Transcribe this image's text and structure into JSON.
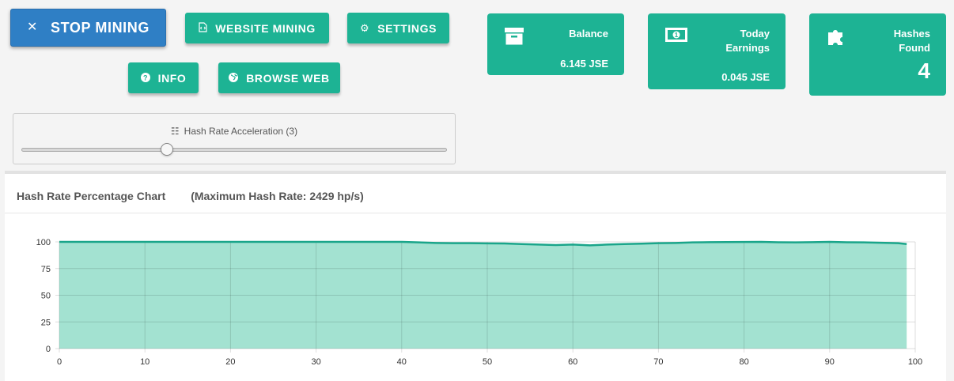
{
  "buttons": {
    "stop_mining": "STOP MINING",
    "website_mining": "WEBSITE MINING",
    "settings": "SETTINGS",
    "info": "INFO",
    "browse_web": "BROWSE WEB"
  },
  "cards": {
    "balance": {
      "label": "Balance",
      "value": "6.145 JSE"
    },
    "today_earnings": {
      "label": "Today Earnings",
      "value": "0.045 JSE"
    },
    "hashes_found": {
      "label": "Hashes Found",
      "value": "4"
    }
  },
  "slider": {
    "label": "Hash Rate Acceleration (3)",
    "value_fraction": 0.34
  },
  "chart_header": {
    "title": "Hash Rate Percentage Chart",
    "subtitle": "(Maximum Hash Rate: 2429 hp/s)"
  },
  "colors": {
    "primary_green": "#1db394",
    "stop_blue": "#2f7fc5",
    "area_fill": "#a3e2d1",
    "line": "#1aa58a"
  },
  "chart_data": {
    "type": "area",
    "title": "Hash Rate Percentage Chart",
    "xlabel": "",
    "ylabel": "",
    "xlim": [
      0,
      100
    ],
    "ylim": [
      0,
      100
    ],
    "x_ticks": [
      0,
      10,
      20,
      30,
      40,
      50,
      60,
      70,
      80,
      90,
      100
    ],
    "y_ticks": [
      0,
      25,
      50,
      75,
      100
    ],
    "grid": true,
    "legend": "none",
    "x": [
      0,
      5,
      10,
      15,
      20,
      25,
      30,
      35,
      40,
      42,
      44,
      46,
      48,
      50,
      52,
      54,
      56,
      58,
      60,
      62,
      64,
      66,
      68,
      70,
      72,
      74,
      76,
      78,
      80,
      82,
      84,
      86,
      88,
      90,
      92,
      94,
      96,
      98,
      99
    ],
    "y": [
      100,
      100,
      100,
      100,
      100,
      100,
      100,
      100,
      100,
      99.5,
      99,
      98.8,
      98.8,
      98.6,
      98.5,
      98,
      97.5,
      97,
      97.5,
      96.8,
      97.5,
      98,
      98.3,
      98.8,
      99,
      99.5,
      99.7,
      99.8,
      99.9,
      100,
      99.6,
      99.5,
      99.7,
      100,
      99.6,
      99.5,
      99.2,
      98.8,
      98
    ]
  }
}
